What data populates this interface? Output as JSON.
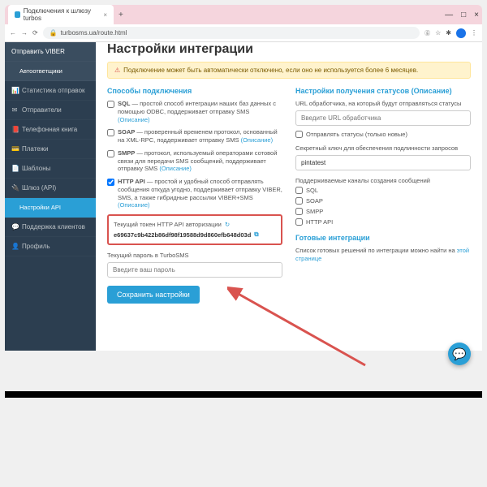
{
  "browser": {
    "tab_title": "Подключения к шлюзу turbos",
    "url": "turbosms.ua/route.html"
  },
  "sidebar": {
    "items": [
      {
        "label": "Отправить VIBER",
        "icon": ""
      },
      {
        "label": "Автоответщики",
        "icon": ""
      },
      {
        "label": "Статистика отправок",
        "icon": "📊"
      },
      {
        "label": "Отправители",
        "icon": "✉"
      },
      {
        "label": "Телефонная книга",
        "icon": "📕"
      },
      {
        "label": "Платежи",
        "icon": "💳"
      },
      {
        "label": "Шаблоны",
        "icon": "📄"
      },
      {
        "label": "Шлюз (API)",
        "icon": "🔌"
      },
      {
        "label": "Настройки API",
        "icon": ""
      },
      {
        "label": "Поддержка клиентов",
        "icon": "💬"
      },
      {
        "label": "Профиль",
        "icon": "👤"
      }
    ]
  },
  "page": {
    "title": "Настройки интеграции",
    "alert": "Подключение может быть автоматически отключено, если оно не используется более 6 месяцев."
  },
  "left": {
    "title": "Способы подключения",
    "sql": "SQL — простой способ интеграции наших баз данных с помощью ODBC, поддерживает отправку SMS",
    "soap": "SOAP — проверенный временем протокол, основанный на XML-RPC, поддерживает отправку SMS",
    "smpp": "SMPP — протокол, используемый операторами сотовой связи для передачи SMS сообщений, поддерживает отправку SMS",
    "http": "HTTP API — простой и удобный способ отправлять сообщения откуда угодно, поддерживает отправку VIBER, SMS, а также гибридные рассылки VIBER+SMS",
    "desc": "(Описание)",
    "token_label": "Текущий токен HTTP API авторизации",
    "token_value": "e69637c9b422b86df98f19588d9d860efb648d03d",
    "pwd_label": "Текущий пароль в TurboSMS",
    "pwd_placeholder": "Введите ваш пароль",
    "save_btn": "Сохранить настройки"
  },
  "right": {
    "title": "Настройки получения статусов (Описание)",
    "url_label": "URL обработчика, на который будут отправляться статусы",
    "url_placeholder": "Введите URL обработчика",
    "new_only": "Отправлять статусы (только новые)",
    "secret_label": "Секретный ключ для обеспечения подлинности запросов",
    "secret_value": "pintatest",
    "channels_label": "Поддерживаемые каналы создания сообщений",
    "ch_sql": "SQL",
    "ch_soap": "SOAP",
    "ch_smpp": "SMPP",
    "ch_http": "HTTP API",
    "ready_title": "Готовые интеграции",
    "ready_text": "Список готовых решений по интеграции можно найти на ",
    "ready_link": "этой странице"
  }
}
